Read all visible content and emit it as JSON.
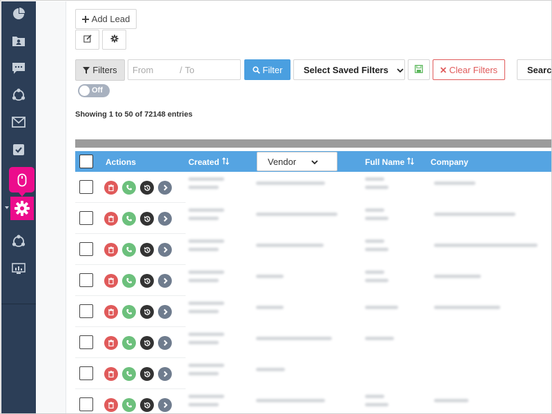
{
  "toolbar": {
    "add_lead": "Add Lead"
  },
  "filters": {
    "filters_button": "Filters",
    "from_placeholder": "From",
    "separator": "/",
    "to_placeholder": "To",
    "filter_button": "Filter",
    "saved_filters_select": "Select Saved Filters",
    "clear_filters": "Clear Filters",
    "search_label": "Search",
    "toggle_label": "Off"
  },
  "table": {
    "showing_text": "Showing 1 to 50 of 72148 entries",
    "columns": {
      "actions": "Actions",
      "created": "Created",
      "vendor": "Vendor",
      "full_name": "Full Name",
      "company": "Company"
    },
    "row_count": 8
  },
  "colors": {
    "sidebar": "#2c3e57",
    "highlight": "#ec0c8c",
    "header": "#55a4e2",
    "delete": "#e05a5a",
    "call": "#6cc07c",
    "history": "#333333",
    "go": "#6f7c8e",
    "filter_button": "#4a9fe0",
    "clear_filters": "#e05a5a",
    "save_filter": "#5cb85c"
  },
  "sidebar_icons": [
    "pie-chart-icon",
    "contacts-folder-icon",
    "chat-icon",
    "share-network-icon",
    "envelope-icon",
    "task-check-icon",
    "mouse-icon",
    "gear-icon",
    "share-network-icon",
    "monitor-dashboard-icon"
  ],
  "row_actions": [
    "trash-icon",
    "phone-icon",
    "history-icon",
    "chevron-right-icon"
  ]
}
